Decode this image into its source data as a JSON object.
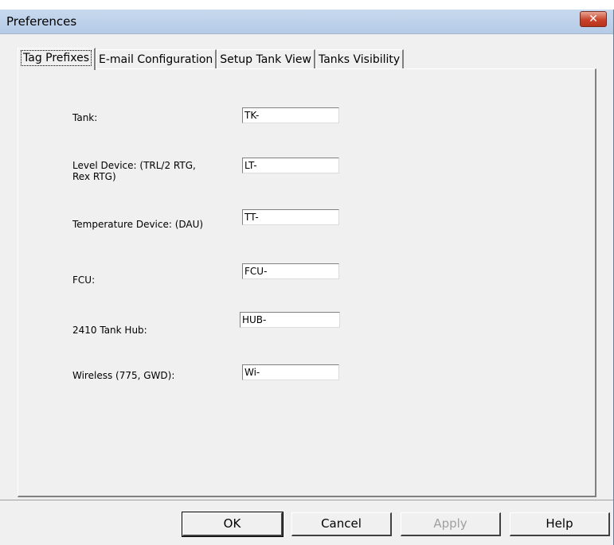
{
  "window": {
    "title": "Preferences",
    "close_glyph": "✕"
  },
  "tabs": [
    {
      "label": "Tag Prefixes",
      "active": true
    },
    {
      "label": "E-mail Configuration",
      "active": false
    },
    {
      "label": "Setup Tank View",
      "active": false
    },
    {
      "label": "Tanks Visibility",
      "active": false
    }
  ],
  "fields": {
    "tank": {
      "label": "Tank:",
      "value": "TK-"
    },
    "level_device": {
      "label_line1": "Level Device:   (TRL/2 RTG,",
      "label_line2": "Rex RTG)",
      "value": "LT-"
    },
    "temperature_device": {
      "label": "Temperature Device: (DAU)",
      "value": "TT-"
    },
    "fcu": {
      "label": "FCU:",
      "value": "FCU-"
    },
    "tank_hub": {
      "label": "2410 Tank Hub:",
      "value": "HUB-"
    },
    "wireless": {
      "label": "Wireless (775, GWD):",
      "value": "Wi-"
    }
  },
  "buttons": {
    "ok": "OK",
    "cancel": "Cancel",
    "apply": "Apply",
    "help": "Help"
  },
  "colors": {
    "close_button": "#c8432a",
    "titlebar": "#c7d9ee",
    "dialog_background": "#f0f0f0"
  }
}
